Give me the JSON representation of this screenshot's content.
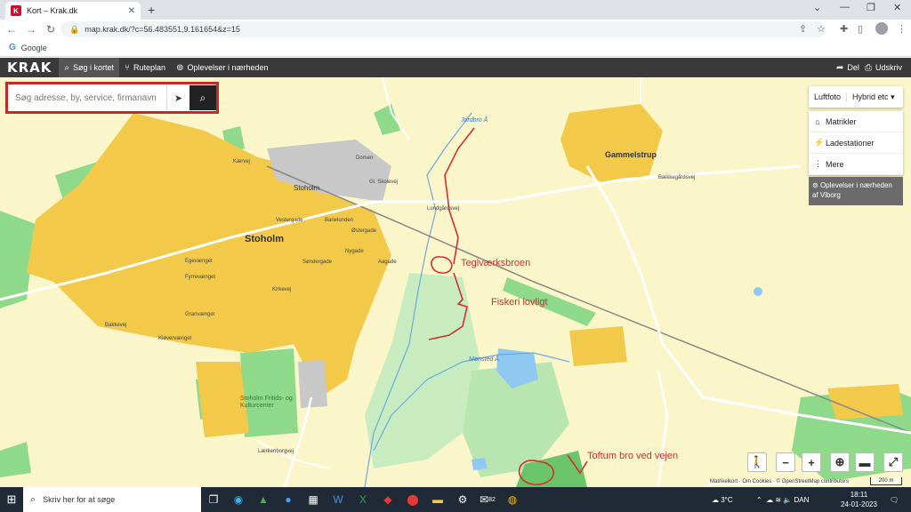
{
  "browser": {
    "tab_title": "Kort – Krak.dk",
    "favicon": "K",
    "url": "map.krak.dk/?c=56.483551,9.161654&z=15",
    "bookmark": "Google"
  },
  "krak": {
    "logo": "KRAK",
    "nav": [
      {
        "label": "Søg i kortet",
        "icon": "search-icon"
      },
      {
        "label": "Ruteplan",
        "icon": "route-icon"
      },
      {
        "label": "Oplevelser i nærheden",
        "icon": "binoculars-icon"
      }
    ],
    "share_label": "Del",
    "print_label": "Udskriv"
  },
  "search": {
    "placeholder": "Søg adresse, by, service, firmanavn"
  },
  "layers": {
    "tabs": [
      "Luftfoto",
      "Hybrid etc"
    ],
    "menu": [
      {
        "label": "Matrikler",
        "icon": "cadastre-icon"
      },
      {
        "label": "Ladestationer",
        "icon": "charging-icon"
      },
      {
        "label": "Mere",
        "icon": "more-icon"
      }
    ],
    "experiences_line1": "Oplevelser i nærheden",
    "experiences_line2": "af Viborg"
  },
  "map_labels": {
    "town": "Stoholm",
    "station": "Stoholm",
    "village": "Gammelstrup",
    "sports": "Stoholm Fritids- og Kulturcenter",
    "stream1": "Jordbro Å",
    "stream2": "Mønsted Å",
    "streets": [
      "Vestergade",
      "Østergade",
      "Nygade",
      "Kirkevej",
      "Søndergade",
      "Banelunden",
      "Lundgårdsvej",
      "Bækkegårdsvej",
      "Lærkenborgvej",
      "Domen",
      "Kærvej",
      "Bakkevej",
      "Kløvervænget",
      "Granvænget",
      "Fyrrevænget",
      "Egevænget",
      "Gl. Skolevej",
      "Aagade"
    ]
  },
  "annotations": {
    "a1": "Teglværksbroen",
    "a2": "Fiskeri lovligt",
    "a3": "Toftum bro  ved vejen"
  },
  "attribution": "Matrikelkort · Om Cookies · © OpenStreetMap contributors",
  "scale": "200 m",
  "taskbar": {
    "search_placeholder": "Skriv her for at søge",
    "temperature": "3°C",
    "language": "DAN",
    "time": "18:11",
    "date": "24-01-2023",
    "badge": "82"
  },
  "colors": {
    "map_bg": "#fbf6c9",
    "builtup": "#f3c94a",
    "green": "#8fd98b",
    "annotation": "#d32f2f"
  }
}
